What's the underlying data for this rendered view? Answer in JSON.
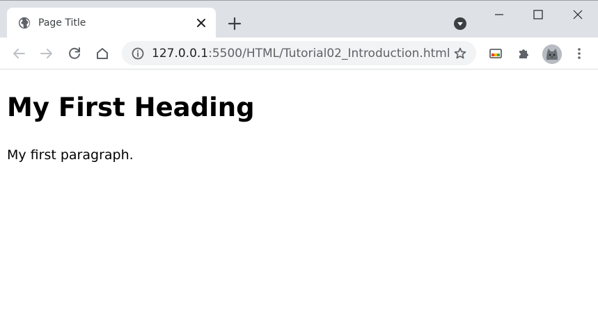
{
  "tab": {
    "title": "Page Title"
  },
  "address_bar": {
    "host": "127.0.0.1",
    "rest": ":5500/HTML/Tutorial02_Introduction.html"
  },
  "page": {
    "heading": "My First Heading",
    "paragraph": "My first paragraph."
  },
  "icons": [
    "globe-icon",
    "close-icon",
    "plus-icon",
    "tab-search-icon",
    "minimize-icon",
    "maximize-icon",
    "window-close-icon",
    "back-arrow-icon",
    "forward-arrow-icon",
    "reload-icon",
    "home-icon",
    "info-icon",
    "star-icon",
    "cast-icon",
    "puzzle-icon",
    "avatar",
    "kebab-menu-icon"
  ]
}
